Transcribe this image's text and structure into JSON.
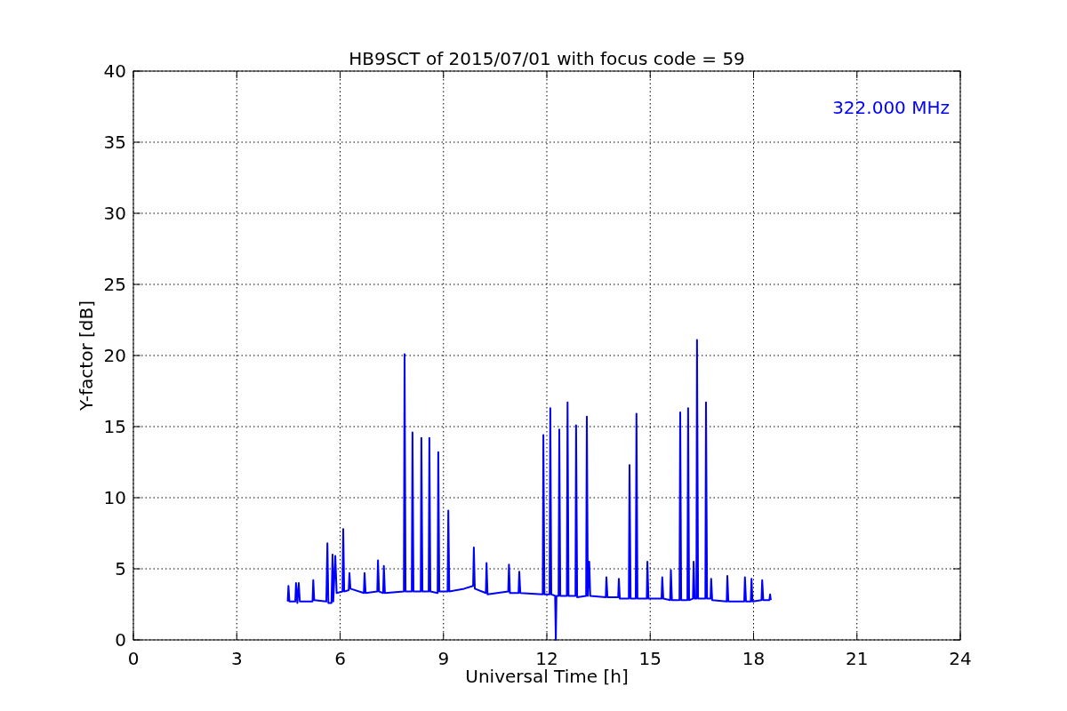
{
  "figure": {
    "chart_data": {
      "type": "line",
      "title": "HB9SCT of 2015/07/01 with focus code = 59",
      "xlabel": "Universal Time [h]",
      "ylabel": "Y-factor [dB]",
      "xlim": [
        0,
        24
      ],
      "ylim": [
        0,
        40
      ],
      "grid": true,
      "xticks": [
        0,
        3,
        6,
        9,
        12,
        15,
        18,
        21,
        24
      ],
      "yticks": [
        0,
        5,
        10,
        15,
        20,
        25,
        30,
        35,
        40
      ],
      "x": [
        4.48,
        4.5,
        4.53,
        4.7,
        4.72,
        4.76,
        4.8,
        4.83,
        5.2,
        5.22,
        5.25,
        5.6,
        5.63,
        5.66,
        5.75,
        5.78,
        5.8,
        5.86,
        5.9,
        6.07,
        6.09,
        6.12,
        6.25,
        6.27,
        6.3,
        6.69,
        6.71,
        6.74,
        7.08,
        7.1,
        7.13,
        7.25,
        7.27,
        7.3,
        7.85,
        7.87,
        7.9,
        8.08,
        8.1,
        8.13,
        8.34,
        8.36,
        8.39,
        8.57,
        8.59,
        8.62,
        8.83,
        8.85,
        8.88,
        9.12,
        9.14,
        9.17,
        9.6,
        9.86,
        9.88,
        9.91,
        10.23,
        10.25,
        10.28,
        10.88,
        10.9,
        10.93,
        11.18,
        11.2,
        11.23,
        11.88,
        11.9,
        11.93,
        12.08,
        12.1,
        12.13,
        12.24,
        12.26,
        12.28,
        12.34,
        12.36,
        12.39,
        12.58,
        12.6,
        12.63,
        12.83,
        12.85,
        12.88,
        13.14,
        13.16,
        13.19,
        13.23,
        13.26,
        13.71,
        13.73,
        13.76,
        14.07,
        14.09,
        14.12,
        14.38,
        14.4,
        14.43,
        14.58,
        14.6,
        14.63,
        14.9,
        14.92,
        14.95,
        15.33,
        15.35,
        15.38,
        15.58,
        15.6,
        15.63,
        15.85,
        15.87,
        15.9,
        16.08,
        16.1,
        16.13,
        16.24,
        16.26,
        16.29,
        16.34,
        16.36,
        16.39,
        16.6,
        16.62,
        16.65,
        16.75,
        16.77,
        16.8,
        17.22,
        17.24,
        17.27,
        17.73,
        17.75,
        17.78,
        17.92,
        17.94,
        17.97,
        18.23,
        18.25,
        18.28,
        18.46,
        18.48,
        18.5
      ],
      "series": [
        {
          "name": "322.000 MHz",
          "color": "#0000ff",
          "values": [
            2.7,
            3.8,
            2.7,
            2.7,
            4.0,
            2.6,
            4.0,
            2.7,
            2.7,
            4.2,
            2.8,
            2.7,
            6.8,
            2.6,
            2.6,
            6.0,
            2.7,
            5.9,
            3.3,
            3.4,
            7.8,
            3.4,
            3.5,
            4.7,
            3.6,
            3.3,
            4.7,
            3.3,
            3.4,
            5.6,
            3.4,
            3.3,
            5.2,
            3.3,
            3.4,
            20.1,
            3.4,
            3.4,
            14.6,
            3.4,
            3.4,
            14.2,
            3.4,
            3.4,
            14.2,
            3.4,
            3.3,
            13.2,
            3.4,
            3.4,
            9.1,
            3.4,
            3.6,
            3.8,
            6.5,
            3.6,
            3.3,
            5.4,
            3.2,
            3.4,
            5.3,
            3.3,
            3.3,
            4.8,
            3.3,
            3.2,
            14.4,
            3.2,
            3.2,
            16.3,
            3.2,
            3.1,
            0,
            3.1,
            3.1,
            14.8,
            3.1,
            3.1,
            16.7,
            3.1,
            3.1,
            15.1,
            3.0,
            3.1,
            15.7,
            3.1,
            5.5,
            3.1,
            3.0,
            4.4,
            3.0,
            3.0,
            4.3,
            2.9,
            2.9,
            12.3,
            2.9,
            2.9,
            15.9,
            2.9,
            2.9,
            5.5,
            2.9,
            2.9,
            4.4,
            2.9,
            2.8,
            4.9,
            2.8,
            2.8,
            16.0,
            2.8,
            2.8,
            16.3,
            2.8,
            2.9,
            5.5,
            2.9,
            2.9,
            21.1,
            2.9,
            2.9,
            16.7,
            2.9,
            2.9,
            4.3,
            2.8,
            2.7,
            4.5,
            2.7,
            2.7,
            4.4,
            2.7,
            2.7,
            4.3,
            2.7,
            2.8,
            4.2,
            2.8,
            2.8,
            3.2,
            2.8
          ]
        }
      ]
    }
  }
}
